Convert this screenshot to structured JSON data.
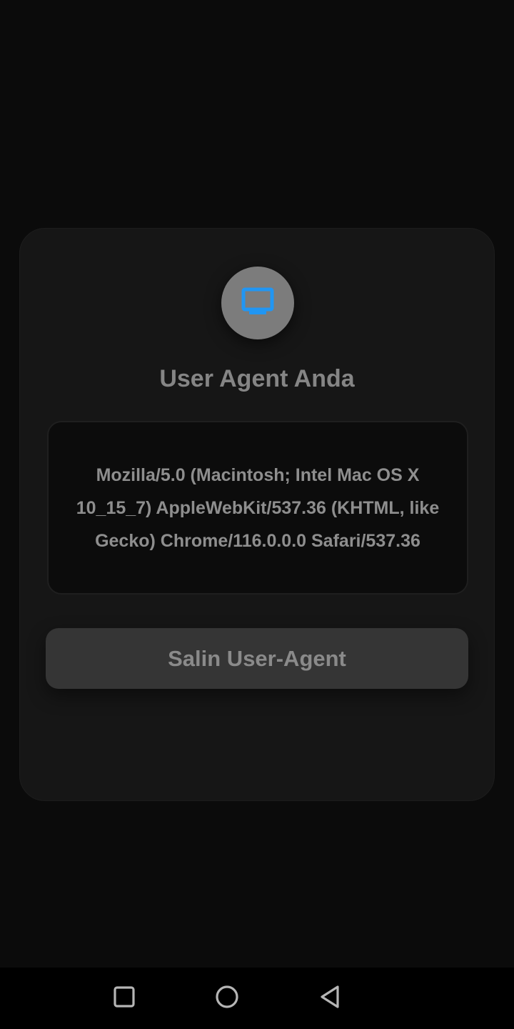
{
  "card": {
    "icon": "monitor-icon",
    "title": "User Agent Anda",
    "user_agent": "Mozilla/5.0 (Macintosh; Intel Mac OS X 10_15_7) AppleWebKit/537.36 (KHTML, like Gecko) Chrome/116.0.0.0 Safari/537.36",
    "copy_button_label": "Salin User-Agent"
  },
  "navbar": {
    "recents_icon": "square-recents-icon",
    "home_icon": "circle-home-icon",
    "back_icon": "triangle-back-icon"
  },
  "colors": {
    "background": "#0b0b0b",
    "card": "#161616",
    "accent_icon": "#2196f3",
    "button": "#353535"
  }
}
